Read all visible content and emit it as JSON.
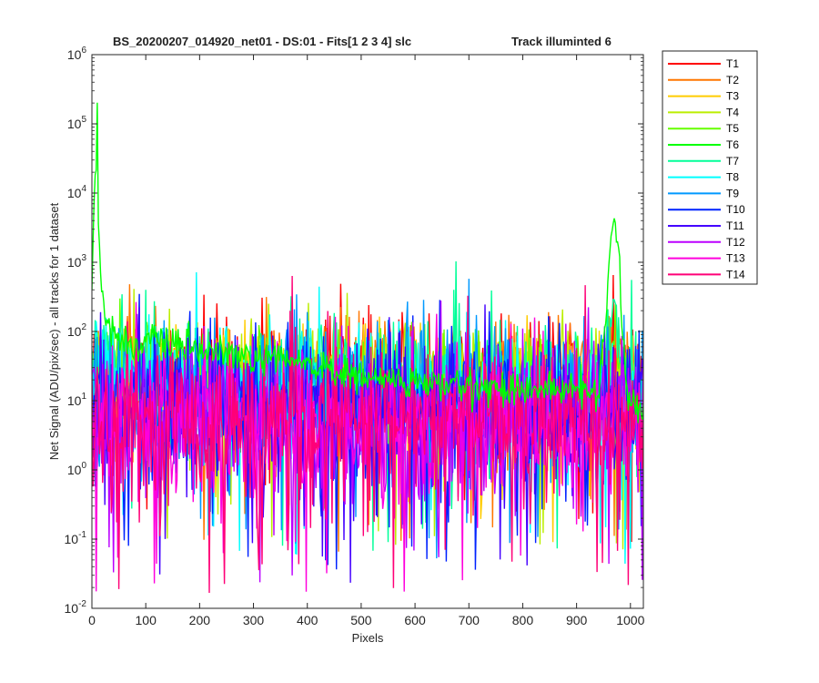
{
  "chart_data": {
    "type": "line",
    "title": "BS_20200207_014920_net01 - DS:01 - Fits[1  2  3  4]   slc",
    "title_right": "Track illuminted 6",
    "xlabel": "Pixels",
    "ylabel": "Net Signal (ADU/pix/sec) - all tracks for 1 dataset",
    "xlim": [
      0,
      1024
    ],
    "ylim": [
      0.01,
      1000000
    ],
    "yscale": "log",
    "xticks": [
      0,
      100,
      200,
      300,
      400,
      500,
      600,
      700,
      800,
      900,
      1000
    ],
    "xtick_labels": [
      "0",
      "100",
      "200",
      "300",
      "400",
      "500",
      "600",
      "700",
      "800",
      "900",
      "1000"
    ],
    "ytick_labels": [
      {
        "base": "10",
        "exp": "-2"
      },
      {
        "base": "10",
        "exp": "-1"
      },
      {
        "base": "10",
        "exp": "0"
      },
      {
        "base": "10",
        "exp": "1"
      },
      {
        "base": "10",
        "exp": "2"
      },
      {
        "base": "10",
        "exp": "3"
      },
      {
        "base": "10",
        "exp": "4"
      },
      {
        "base": "10",
        "exp": "5"
      },
      {
        "base": "10",
        "exp": "6"
      }
    ],
    "ytick_values": [
      0.01,
      0.1,
      1,
      10,
      100,
      1000,
      10000,
      100000,
      1000000
    ],
    "grid": false,
    "legend_position": "outside-right",
    "series": [
      {
        "name": "T1",
        "color": "#ff0000",
        "baseline": [
          [
            0,
            22
          ],
          [
            1024,
            22
          ]
        ],
        "noise": 0.45
      },
      {
        "name": "T2",
        "color": "#ff7700",
        "baseline": [
          [
            0,
            20
          ],
          [
            1024,
            20
          ]
        ],
        "noise": 0.45
      },
      {
        "name": "T3",
        "color": "#ffcc00",
        "baseline": [
          [
            0,
            28
          ],
          [
            200,
            24
          ],
          [
            1024,
            20
          ]
        ],
        "noise": 0.35
      },
      {
        "name": "T4",
        "color": "#bbee00",
        "baseline": [
          [
            0,
            30
          ],
          [
            200,
            25
          ],
          [
            1024,
            20
          ]
        ],
        "noise": 0.35
      },
      {
        "name": "T5",
        "color": "#66ff00",
        "baseline": [
          [
            0,
            40
          ],
          [
            100,
            30
          ],
          [
            300,
            22
          ],
          [
            1024,
            16
          ]
        ],
        "noise": 0.3,
        "peaks": [
          [
            963,
            60
          ],
          [
            970,
            80
          ]
        ]
      },
      {
        "name": "T6",
        "color": "#00ff00",
        "baseline": [
          [
            0,
            300
          ],
          [
            3,
            5000
          ],
          [
            8,
            30000
          ],
          [
            10,
            400000
          ],
          [
            12,
            5000
          ],
          [
            16,
            800
          ],
          [
            22,
            200
          ],
          [
            40,
            90
          ],
          [
            60,
            70
          ],
          [
            100,
            60
          ],
          [
            120,
            80
          ],
          [
            150,
            60
          ],
          [
            200,
            55
          ],
          [
            250,
            45
          ],
          [
            300,
            40
          ],
          [
            400,
            35
          ],
          [
            450,
            25
          ],
          [
            500,
            22
          ],
          [
            600,
            18
          ],
          [
            700,
            16
          ],
          [
            800,
            15
          ],
          [
            900,
            14
          ],
          [
            940,
            14
          ],
          [
            955,
            200
          ],
          [
            962,
            1500
          ],
          [
            968,
            3500
          ],
          [
            972,
            2500
          ],
          [
            978,
            2000
          ],
          [
            985,
            100
          ],
          [
            995,
            10
          ],
          [
            1024,
            8
          ]
        ],
        "noise": 0.12
      },
      {
        "name": "T7",
        "color": "#00ff99",
        "baseline": [
          [
            0,
            25
          ],
          [
            200,
            22
          ],
          [
            1024,
            18
          ]
        ],
        "noise": 0.45,
        "peaks": [
          [
            965,
            100
          ],
          [
            970,
            130
          ]
        ]
      },
      {
        "name": "T8",
        "color": "#00ffff",
        "baseline": [
          [
            0,
            30
          ],
          [
            100,
            20
          ],
          [
            300,
            15
          ],
          [
            1024,
            12
          ]
        ],
        "noise": 0.45
      },
      {
        "name": "T9",
        "color": "#0099ff",
        "baseline": [
          [
            0,
            15
          ],
          [
            1024,
            12
          ]
        ],
        "noise": 0.5
      },
      {
        "name": "T10",
        "color": "#0022ff",
        "baseline": [
          [
            0,
            8
          ],
          [
            1024,
            8
          ]
        ],
        "noise": 0.55
      },
      {
        "name": "T11",
        "color": "#4400ff",
        "baseline": [
          [
            0,
            7
          ],
          [
            1024,
            7
          ]
        ],
        "noise": 0.55
      },
      {
        "name": "T12",
        "color": "#bb00ff",
        "baseline": [
          [
            0,
            6
          ],
          [
            1024,
            6
          ]
        ],
        "noise": 0.55
      },
      {
        "name": "T13",
        "color": "#ff00dd",
        "baseline": [
          [
            0,
            5
          ],
          [
            1024,
            5
          ]
        ],
        "noise": 0.55
      },
      {
        "name": "T14",
        "color": "#ff0077",
        "baseline": [
          [
            0,
            5
          ],
          [
            1024,
            5
          ]
        ],
        "noise": 0.55
      }
    ]
  }
}
